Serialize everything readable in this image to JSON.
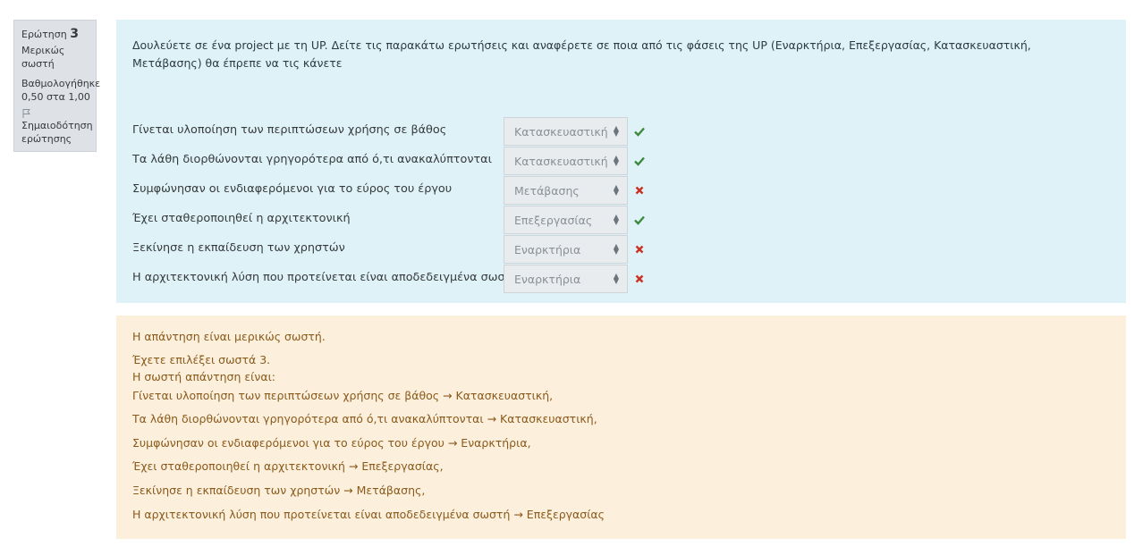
{
  "info": {
    "question_label": "Ερώτηση",
    "question_number": "3",
    "state": "Μερικώς σωστή",
    "grade_line1": "Βαθμολογήθηκε",
    "grade_line2": "0,50 στα 1,00",
    "flag_label_line1": "Σημαιοδότηση",
    "flag_label_line2": "ερώτησης",
    "flag_icon": "flag-icon"
  },
  "question": {
    "text": "Δουλεύετε σε ένα project με τη UP. Δείτε τις παρακάτω ερωτήσεις και αναφέρετε σε ποια από τις φάσεις της UP (Εναρκτήρια, Επεξεργασίας, Κατασκευαστική, Μετάβασης) θα έπρεπε να τις κάνετε",
    "rows": [
      {
        "label": "Γίνεται υλοποίηση των περιπτώσεων χρήσης σε βάθος",
        "selected": "Κατασκευαστική",
        "mark": "check-icon"
      },
      {
        "label": "Τα λάθη διορθώνονται γρηγορότερα από ό,τι ανακαλύπτονται",
        "selected": "Κατασκευαστική",
        "mark": "check-icon"
      },
      {
        "label": "Συμφώνησαν οι ενδιαφερόμενοι για το εύρος του έργου",
        "selected": "Μετάβασης",
        "mark": "cross-icon"
      },
      {
        "label": "Έχει σταθεροποιηθεί η αρχιτεκτονική",
        "selected": "Επεξεργασίας",
        "mark": "check-icon"
      },
      {
        "label": "Ξεκίνησε η εκπαίδευση των χρηστών",
        "selected": "Εναρκτήρια",
        "mark": "cross-icon"
      },
      {
        "label": "Η αρχιτεκτονική λύση που προτείνεται είναι αποδεδειγμένα σωστή",
        "selected": "Εναρκτήρια",
        "mark": "cross-icon"
      }
    ]
  },
  "feedback": {
    "summary": "Η απάντηση είναι μερικώς σωστή.",
    "selected_count": "Έχετε επιλέξει σωστά 3.",
    "right_answer_intro": "Η σωστή απάντηση είναι:",
    "answers": [
      "Γίνεται υλοποίηση των περιπτώσεων χρήσης σε βάθος → Κατασκευαστική,",
      "Τα λάθη διορθώνονται γρηγορότερα από ό,τι ανακαλύπτονται → Κατασκευαστική,",
      "Συμφώνησαν οι ενδιαφερόμενοι για το εύρος του έργου → Εναρκτήρια,",
      "Έχει σταθεροποιηθεί η αρχιτεκτονική → Επεξεργασίας,",
      "Ξεκίνησε η εκπαίδευση των χρηστών → Μετάβασης,",
      "Η αρχιτεκτονική λύση που προτείνεται είναι αποδεδειγμένα σωστή → Επεξεργασίας"
    ]
  },
  "colors": {
    "correct": "#3d8a3d",
    "incorrect": "#ca3120"
  }
}
